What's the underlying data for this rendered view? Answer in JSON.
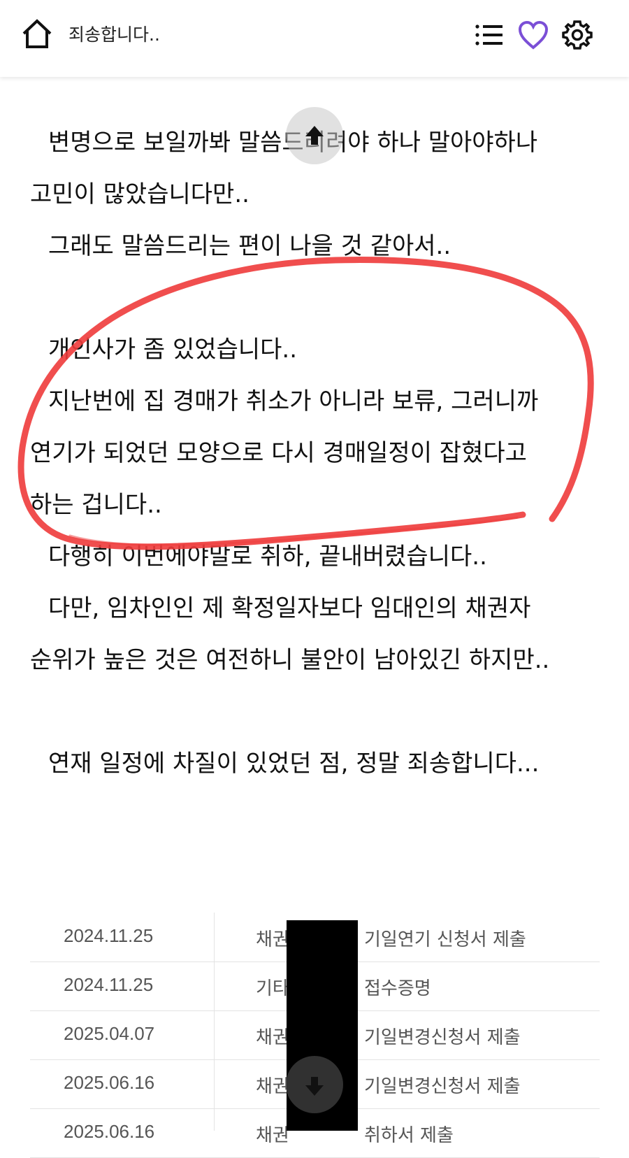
{
  "header": {
    "title": "죄송합니다..",
    "icons": [
      "home-icon",
      "list-icon",
      "heart-icon",
      "gear-icon"
    ],
    "accent_color": "#7b4fd6"
  },
  "body": {
    "lines": [
      "변명으로 보일까봐 말씀드리려야 하나 말아야하나",
      "고민이 많았습니다만..",
      "그래도 말씀드리는 편이 나을 것 같아서..",
      "개인사가 좀 있었습니다..",
      "지난번에 집 경매가 취소가 아니라 보류, 그러니까",
      "연기가 되었던 모양으로 다시 경매일정이 잡혔다고",
      "하는 겁니다..",
      "다행히 이번에야말로 취하, 끝내버렸습니다..",
      "다만, 임차인인 제 확정일자보다 임대인의 채권자",
      "순위가 높은 것은 여전하니 불안이 남아있긴 하지만..",
      "연재 일정에 차질이 있었던 점, 정말 죄송합니다..."
    ]
  },
  "table": {
    "rows": [
      {
        "date": "2024.11.25",
        "prefix": "채권",
        "desc": "기일연기 신청서 제출"
      },
      {
        "date": "2024.11.25",
        "prefix": "기타",
        "desc": "접수증명"
      },
      {
        "date": "2025.04.07",
        "prefix": "채권",
        "desc": "기일변경신청서 제출"
      },
      {
        "date": "2025.06.16",
        "prefix": "채권",
        "desc": "기일변경신청서 제출"
      },
      {
        "date": "2025.06.16",
        "prefix": "채권",
        "desc": "취하서 제출"
      }
    ]
  },
  "annotation_color": "#ee3b3b"
}
